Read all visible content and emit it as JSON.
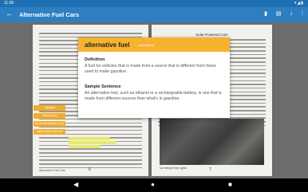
{
  "status_bar": {
    "time": "11:56",
    "system_icons": "▾◢▮"
  },
  "app_bar": {
    "title": "Alternative Fuel Cars",
    "back_icon": "←",
    "actions": [
      {
        "name": "bookmark-icon",
        "glyph": "▮"
      },
      {
        "name": "comment-icon",
        "glyph": "▤"
      },
      {
        "name": "microphone-icon",
        "glyph": "♪"
      },
      {
        "name": "more-options-icon",
        "glyph": "⋮"
      }
    ]
  },
  "book": {
    "left_page_number": "6",
    "right_page_number": "7",
    "left_footer": "Alternative Fuel Cars",
    "right_heading": "Solar-Powered Cars",
    "photo_caption": "Car being lit by Lights"
  },
  "selection_menu": [
    "Highlight",
    "Read Aloud",
    "Show Vocabulary Card",
    "Add to Word Journal"
  ],
  "definition_popup": {
    "word": "alternative fuel",
    "part_of_speech": "noun (idea)",
    "definition_label": "Definition",
    "definition_text": "A fuel for vehicles that is made from a source that is different from those used to make gasoline.",
    "sample_label": "Sample Sentence",
    "sample_text": "An alternative fuel, such as ethanol or a rechargeable battery, is one that is made from different sources than what's in gasoline."
  },
  "nav_bar": {
    "back": "◀",
    "home": "●",
    "recents": "■"
  },
  "colors": {
    "app_bar": "#2e7fc1",
    "popup_header": "#f6b330",
    "menu_button": "#f0ad2c",
    "highlight": "#e5e872"
  }
}
